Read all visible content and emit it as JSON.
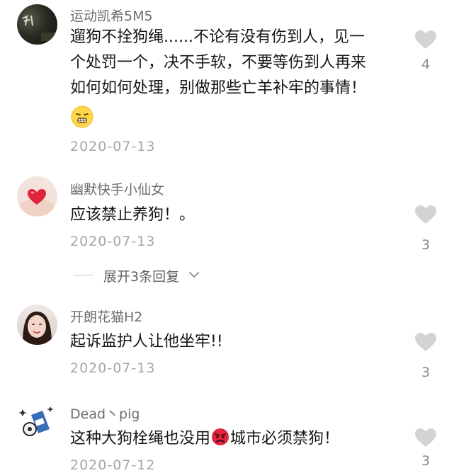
{
  "comments": [
    {
      "username": "运动凯希5M5",
      "lines": [
        "遛狗不拴狗绳......不论有没有伤到人，见一",
        "个处罚一个，决不手软，不要等伤到人再来",
        "如何如何处理，别做那些亡羊补牢的事情！"
      ],
      "emoji": "grimace-emoji-icon",
      "date": "2020-07-13",
      "likes": "4"
    },
    {
      "username": "幽默快手小仙女",
      "text": "应该禁止养狗！。",
      "date": "2020-07-13",
      "likes": "3"
    },
    {
      "username": "开朗花猫H2",
      "text": "起诉监护人让他坐牢!!",
      "date": "2020-07-13",
      "likes": "3"
    },
    {
      "username": "Dead丶pig",
      "text_before": "这种大狗栓绳也没用",
      "emoji": "angry-face-emoji-icon",
      "text_after": "城市必须禁狗！",
      "date": "2020-07-12",
      "likes": "3"
    }
  ],
  "expand_replies": {
    "label": "展开3条回复",
    "icon": "chevron-down-icon"
  },
  "colors": {
    "heart": "#d3d3d3",
    "username": "#6d6d6d",
    "date": "#a6a6a6",
    "text": "#161616",
    "angry": "#e0243e",
    "emoji_yellow": "#ffd84a"
  }
}
